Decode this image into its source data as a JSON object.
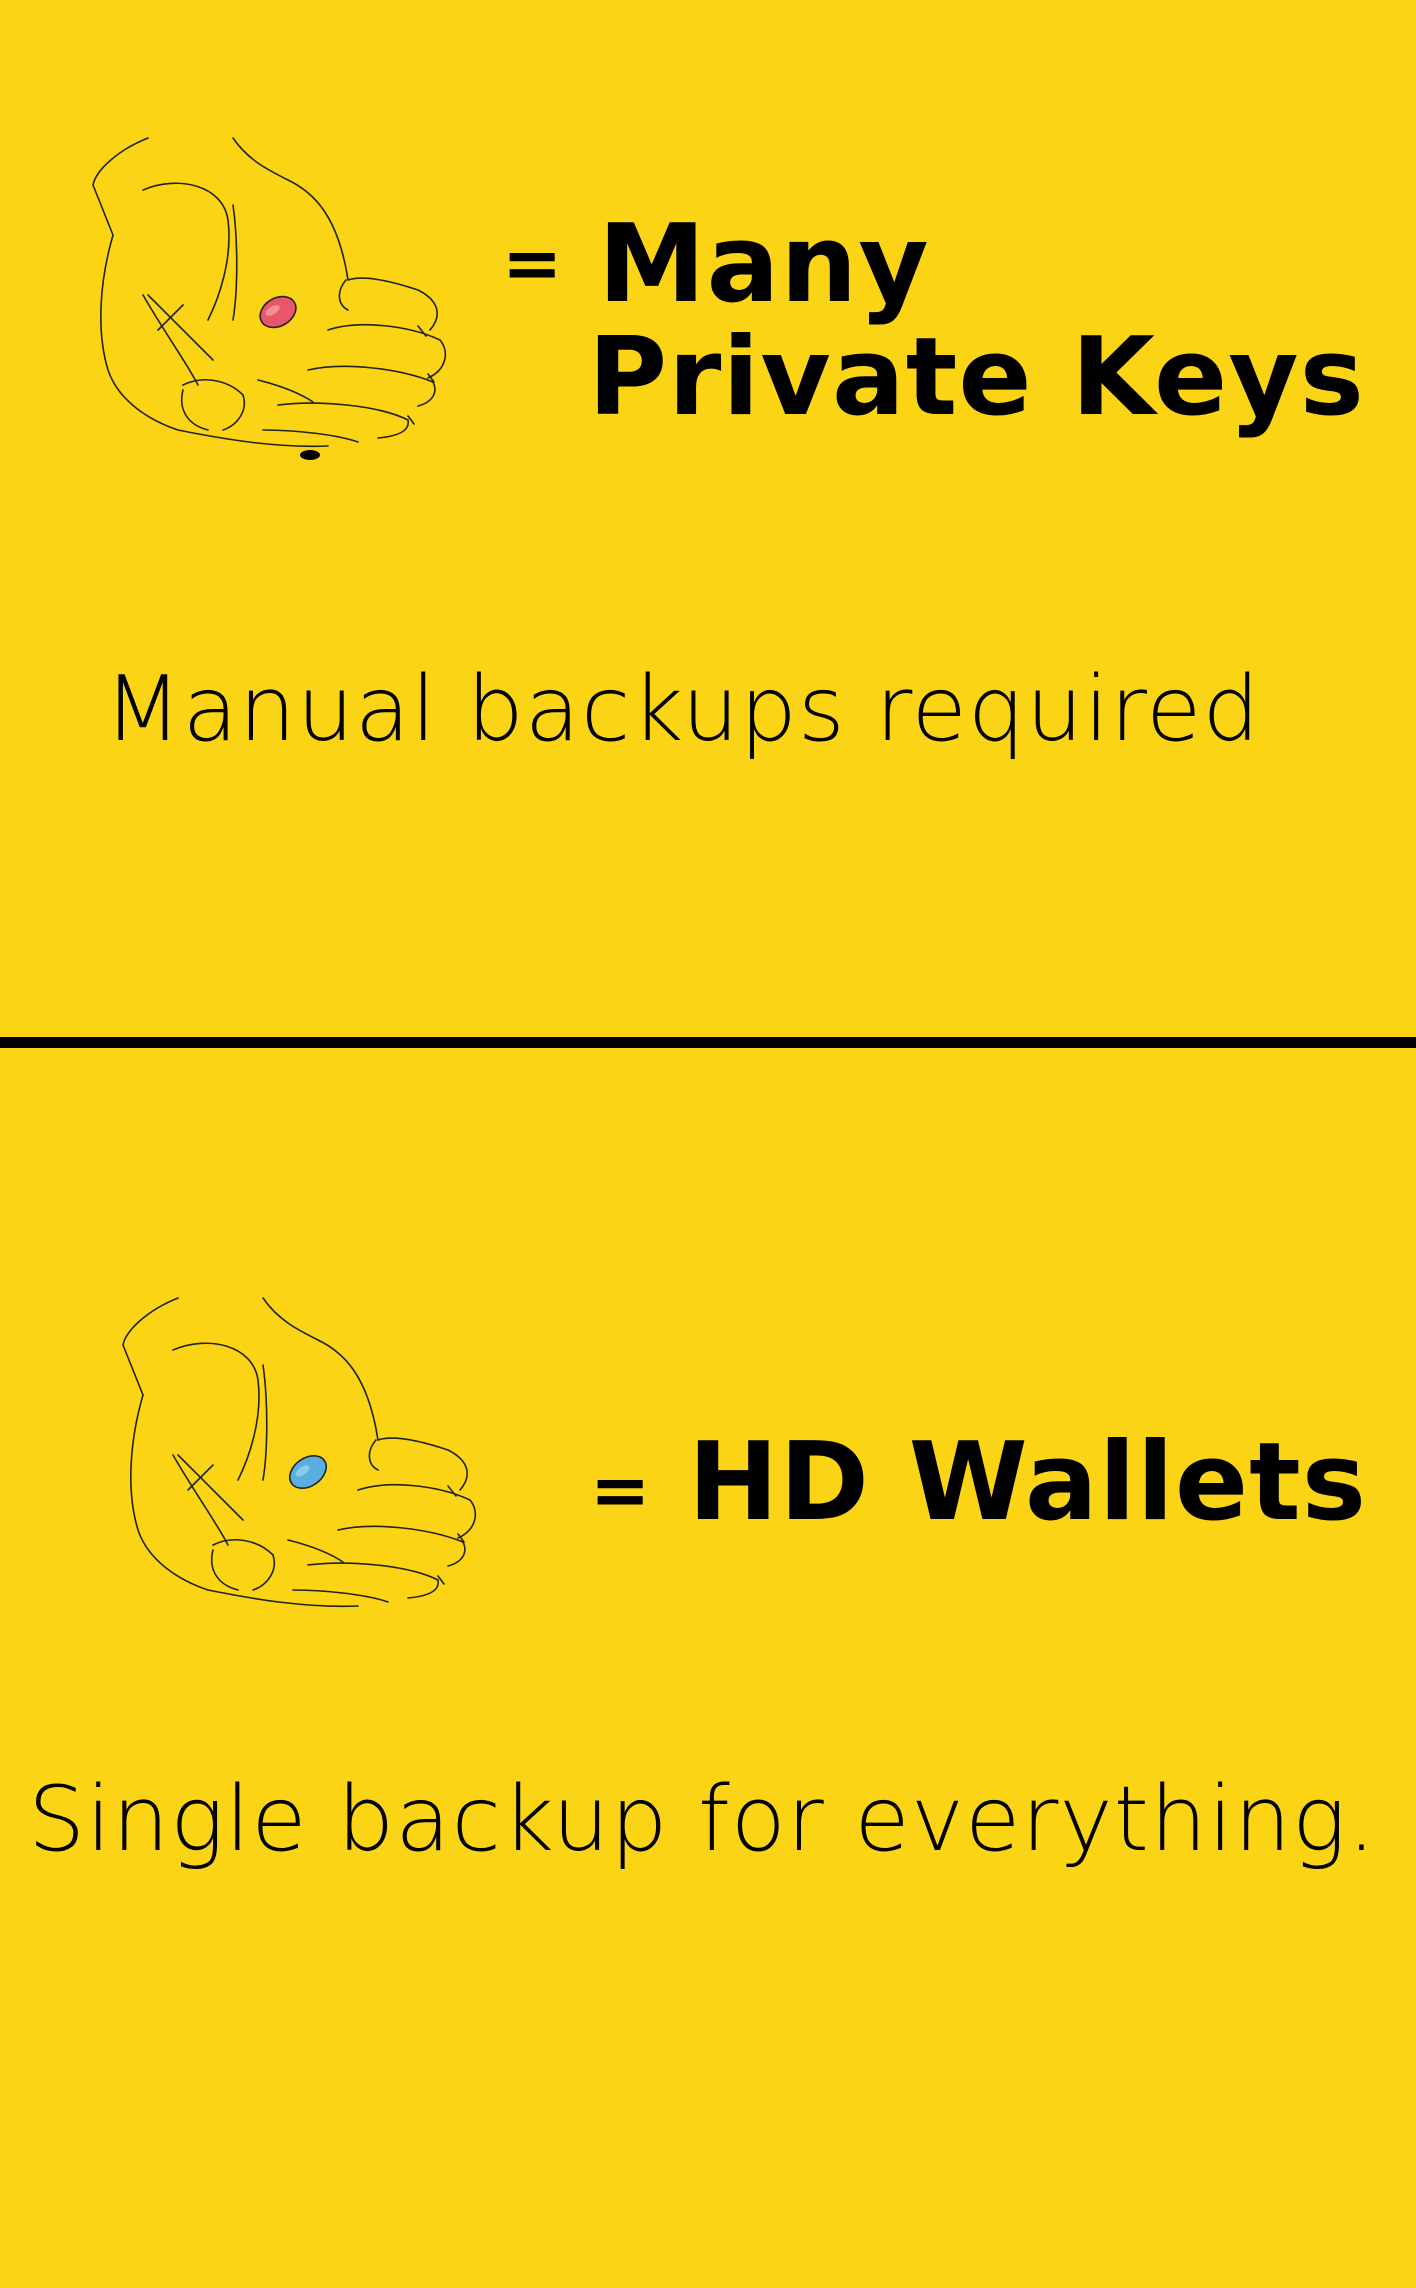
{
  "colors": {
    "background": "#FBD415",
    "divider": "#000000",
    "text": "#000000",
    "pill_top": "#E8566A",
    "pill_bottom": "#5BAEE0"
  },
  "top_panel": {
    "icon": "hand-with-red-pill-icon",
    "equals": "=",
    "heading_line1": "Many",
    "heading_line2": "Private Keys",
    "caption": "Manual backups required"
  },
  "bottom_panel": {
    "icon": "hand-with-blue-pill-icon",
    "equals": "=",
    "heading": "HD Wallets",
    "caption": "Single backup for everything."
  }
}
